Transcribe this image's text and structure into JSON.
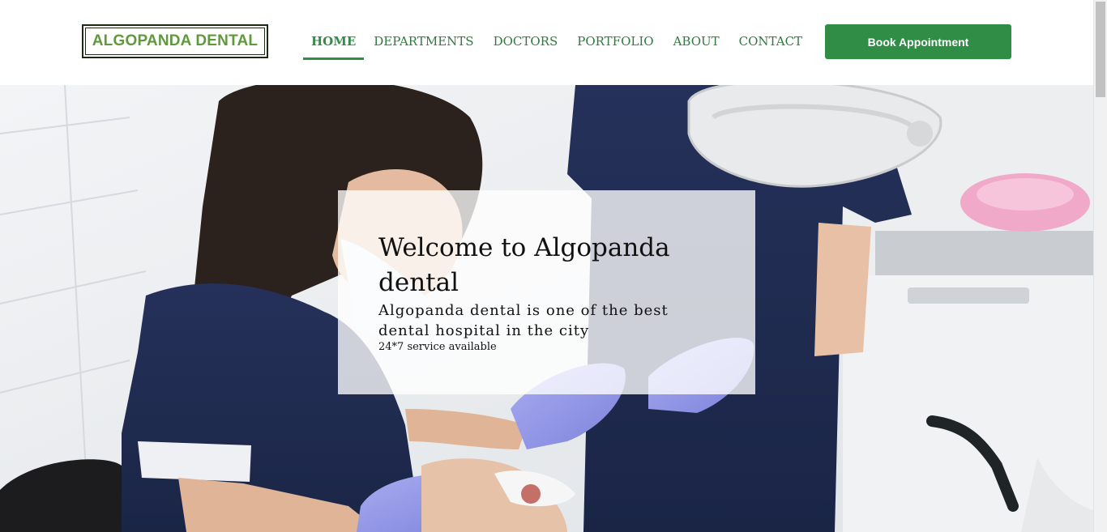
{
  "header": {
    "logo_text": "ALGOPANDA DENTAL",
    "nav": [
      {
        "label": "HOME",
        "active": true
      },
      {
        "label": "DEPARTMENTS",
        "active": false
      },
      {
        "label": "DOCTORS",
        "active": false
      },
      {
        "label": "PORTFOLIO",
        "active": false
      },
      {
        "label": "ABOUT",
        "active": false
      },
      {
        "label": "CONTACT",
        "active": false
      }
    ],
    "cta_label": "Book Appointment"
  },
  "hero": {
    "title": "Welcome to Algopanda dental",
    "subtitle": "Algopanda dental is one of the best dental hospital in the city",
    "note": "24*7 service available"
  },
  "colors": {
    "brand_green": "#2f8d46",
    "logo_green": "#5f9a3a",
    "nav_green": "#2f7a3c"
  }
}
